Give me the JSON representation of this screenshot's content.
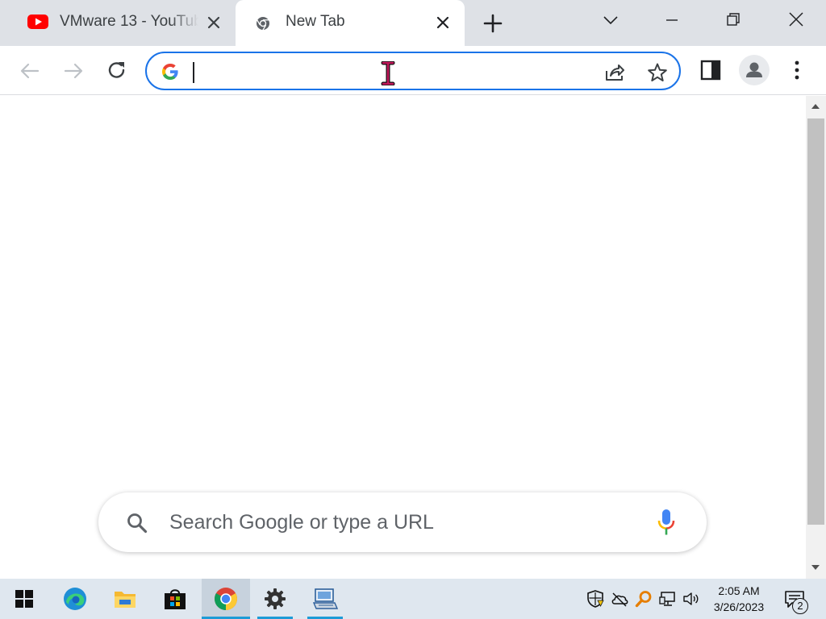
{
  "tabs": [
    {
      "title": "VMware 13 - YouTube",
      "favicon": "youtube-icon",
      "active": false
    },
    {
      "title": "New Tab",
      "favicon": "chrome-icon",
      "active": true
    }
  ],
  "omnibox": {
    "value": "",
    "placeholder": ""
  },
  "ntp": {
    "search_placeholder": "Search Google or type a URL"
  },
  "taskbar": {
    "apps": [
      "start-icon",
      "edge-icon",
      "file-explorer-icon",
      "microsoft-store-icon",
      "chrome-icon",
      "settings-icon",
      "remote-desktop-icon"
    ],
    "clock_time": "2:05 AM",
    "clock_date": "3/26/2023",
    "notification_count": "2"
  },
  "colors": {
    "accent": "#1a73e8",
    "tabstrip": "#dee1e6",
    "taskbar": "#dfe7ef"
  }
}
